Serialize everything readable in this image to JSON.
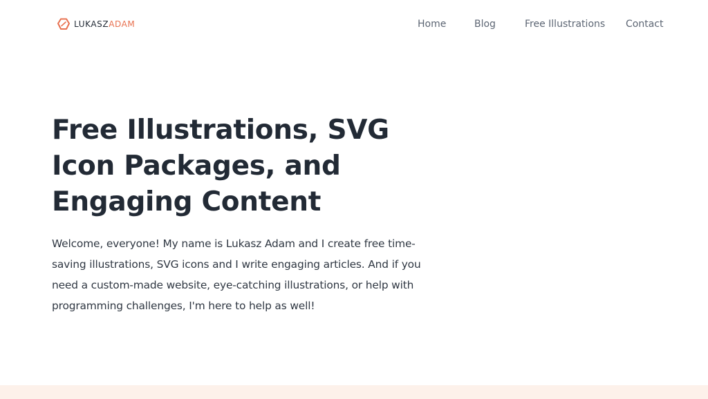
{
  "logo": {
    "first": "LUKASZ",
    "last": "ADAM",
    "mark_icon": "hexagon-badge-icon"
  },
  "nav": {
    "home": "Home",
    "blog": "Blog",
    "free_illustrations": "Free Illustrations",
    "contact": "Contact"
  },
  "hero": {
    "title": "Free Illustrations, SVG Icon Packages, and Engaging Content",
    "text": "Welcome, everyone! My name is Lukasz Adam and I create free time-saving illustrations, SVG icons and I write engaging articles. And if you need a custom-made website, eye-catching illustrations, or help with programming challenges, I'm here to help as well!"
  },
  "colors": {
    "accent": "#e8704f",
    "heading": "#222a35",
    "nav_text": "#5c6573",
    "bottom_band": "#fdf1ea"
  }
}
